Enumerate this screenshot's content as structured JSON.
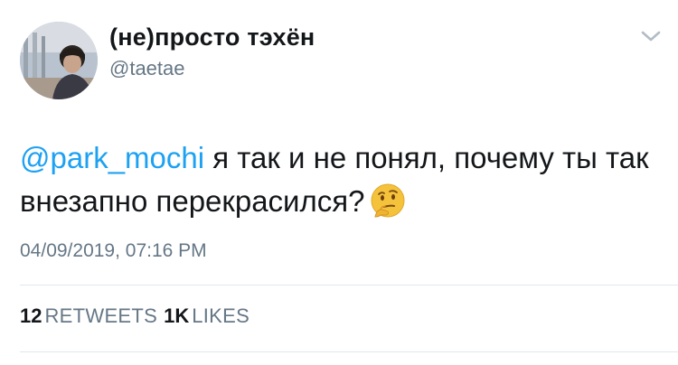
{
  "user": {
    "display_name": "(не)просто тэхён",
    "handle": "@taetae"
  },
  "tweet": {
    "mention": "@park_mochi",
    "text": " я так и не понял, почему ты так внезапно перекрасился?",
    "emoji": "thinking-face",
    "timestamp": "04/09/2019, 07:16 PM"
  },
  "stats": {
    "retweets_count": "12",
    "retweets_label": "RETWEETS",
    "likes_count": "1K",
    "likes_label": "LIKES"
  },
  "colors": {
    "mention": "#1da1f2",
    "secondary_text": "#657786",
    "primary_text": "#14171a",
    "divider": "#e1e8ed"
  }
}
